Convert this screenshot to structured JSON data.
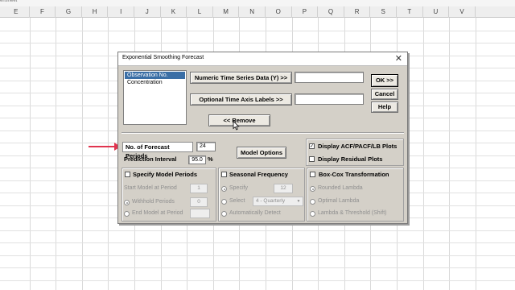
{
  "spreadsheet": {
    "columns": [
      "E",
      "F",
      "G",
      "H",
      "I",
      "J",
      "K",
      "L",
      "M",
      "N",
      "O",
      "P",
      "Q",
      "R",
      "S",
      "T",
      "U",
      "V"
    ],
    "topstrip_text": "ensheet"
  },
  "dialog": {
    "title": "Exponential Smoothing Forecast",
    "close_glyph": "✕",
    "variables": [
      "Observation No.",
      "Concentration"
    ],
    "buttons": {
      "numeric_series": "Numeric Time Series Data (Y) >>",
      "axis_labels": "Optional Time Axis Labels >>",
      "remove": "<< Remove",
      "ok": "OK >>",
      "cancel": "Cancel",
      "help": "Help",
      "model_options": "Model Options"
    },
    "forecast_periods_label": "No. of Forecast Periods",
    "forecast_periods_value": "24",
    "prediction_interval_label": "Prediction Interval",
    "prediction_interval_value": "95.0",
    "prediction_interval_unit": "%",
    "display_acf": "Display ACF/PACF/LB Plots",
    "display_acf_checked": true,
    "display_residual": "Display Residual Plots",
    "specify_model_periods": "Specify Model Periods",
    "start_model_label": "Start Model at Period",
    "start_model_value": "1",
    "withhold_label": "Withhold Periods",
    "withhold_value": "0",
    "end_model_label": "End Model at Period",
    "end_model_value": "",
    "seasonal_frequency": "Seasonal Frequency",
    "specify_label": "Specify",
    "specify_value": "12",
    "select_label": "Select",
    "select_value": "4 - Quarterly",
    "auto_detect": "Automatically Detect",
    "boxcox": "Box-Cox Transformation",
    "rounded_lambda": "Rounded Lambda",
    "optimal_lambda": "Optimal Lambda",
    "lambda_threshold": "Lambda & Threshold (Shift)"
  },
  "annotation_color": "#e0344e",
  "icons": {
    "close": "close-icon",
    "pointer": "mouse-pointer-icon",
    "arrow": "annotation-arrow-icon"
  }
}
